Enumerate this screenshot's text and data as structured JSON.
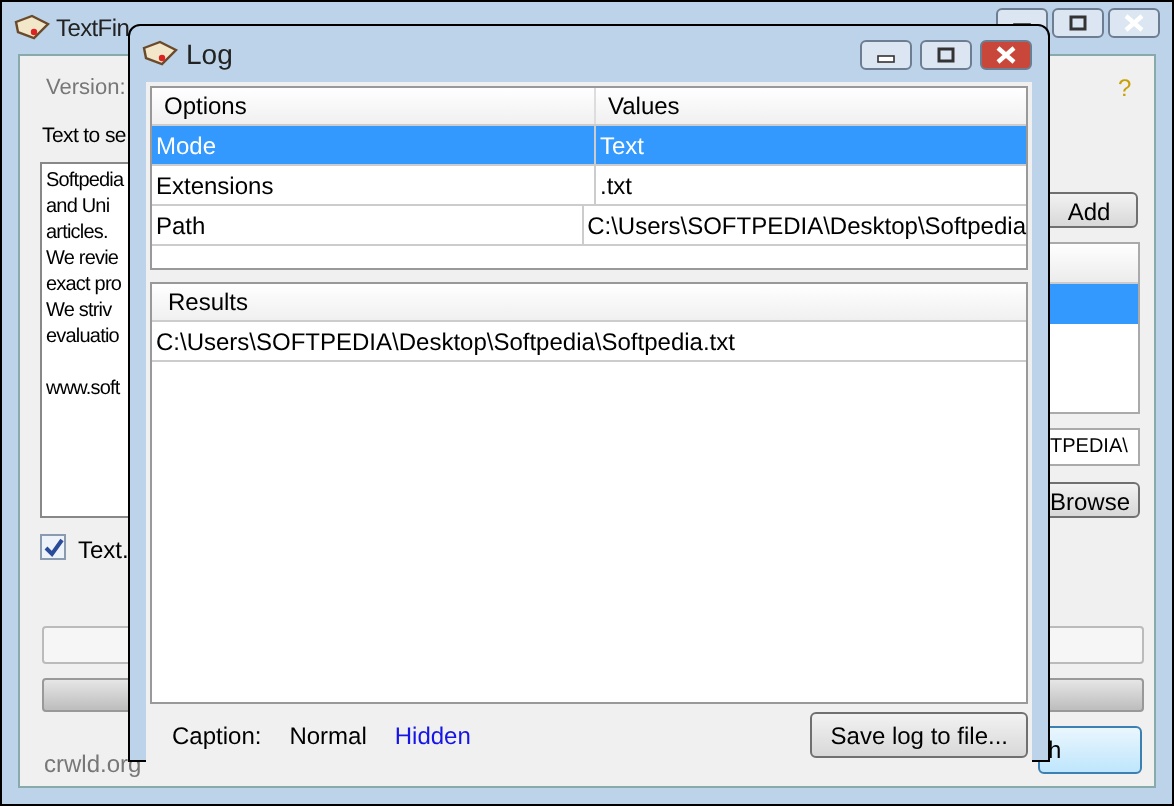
{
  "main_window": {
    "title": "TextFin",
    "version_label": "Version:",
    "help": "?",
    "search_label": "Text to se",
    "text_lines": [
      "Softpedia",
      "and Uni",
      "articles.",
      "We revie",
      "exact pro",
      "We striv",
      "evaluatio"
    ],
    "url_line": "www.soft",
    "add_button": "Add",
    "list_rows": [
      {
        "selected": true
      }
    ],
    "path_value": "TPEDIA\\",
    "browse_button": "Browse",
    "text_checkbox": {
      "label": "Text.",
      "checked": true
    },
    "progress": {
      "level": 0.0
    },
    "footer_link": "crwld.org",
    "search_button": "h"
  },
  "log_window": {
    "title": "Log",
    "options_table": {
      "columns": [
        "Options",
        "Values"
      ],
      "rows": [
        {
          "option": "Mode",
          "value": "Text",
          "selected": true
        },
        {
          "option": "Extensions",
          "value": ".txt",
          "selected": false
        },
        {
          "option": "Path",
          "value": "C:\\Users\\SOFTPEDIA\\Desktop\\Softpedia",
          "selected": false
        }
      ]
    },
    "results_table": {
      "columns": [
        "Results"
      ],
      "rows": [
        "C:\\Users\\SOFTPEDIA\\Desktop\\Softpedia\\Softpedia.txt"
      ]
    },
    "caption_label": "Caption:",
    "caption_options": [
      {
        "label": "Normal",
        "selected": true
      },
      {
        "label": "Hidden",
        "selected": false
      }
    ],
    "save_button": "Save log to file..."
  }
}
